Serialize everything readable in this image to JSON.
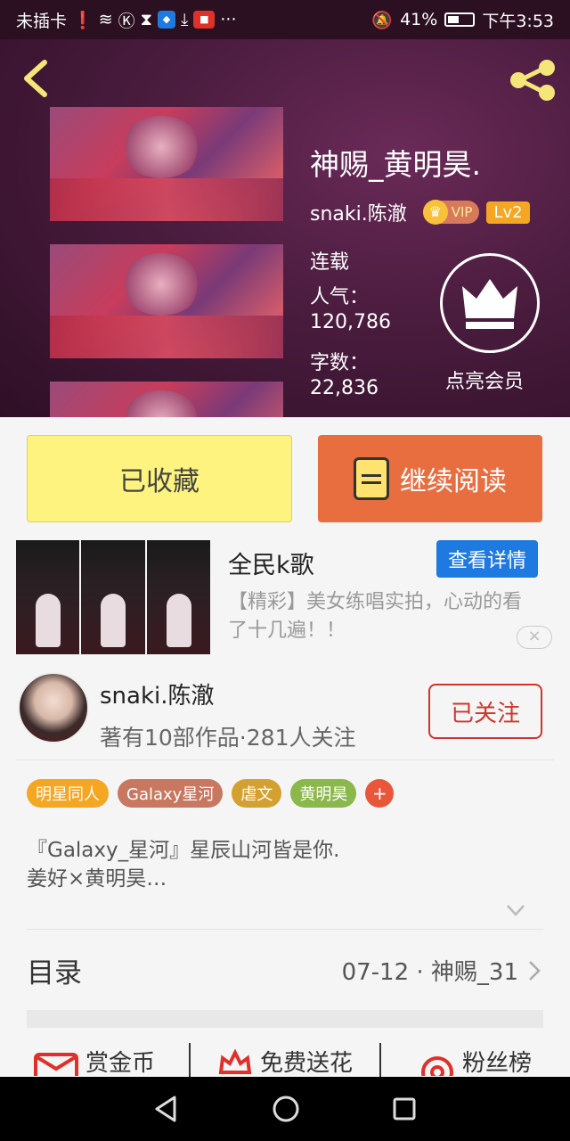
{
  "status_bar": {
    "carrier": "未插卡",
    "battery": "41%",
    "time": "下午3:53",
    "more": "···"
  },
  "book": {
    "title": "神赐_黄明昊.",
    "author": "snaki.陈澈",
    "vip": "VIP",
    "level": "Lv2",
    "status": "连载",
    "popularity_label": "人气：",
    "popularity_value": "120,786",
    "words_label": "字数：",
    "words_value": "22,836",
    "member_label": "点亮会员"
  },
  "actions": {
    "favorited_label": "已收藏",
    "continue_label": "继续阅读"
  },
  "ad": {
    "title": "全民k歌",
    "details_button": "查看详情",
    "description": "【精彩】美女练唱实拍，心动的看了十几遍！！",
    "close": "×"
  },
  "author_block": {
    "name": "snaki.陈澈",
    "works": "著有10部作品·281人关注",
    "follow_label": "已关注"
  },
  "tags": [
    {
      "label": "明星同人",
      "color": "#f5a623"
    },
    {
      "label": "Galaxy星河",
      "color": "#c87860"
    },
    {
      "label": "虐文",
      "color": "#d4a030"
    },
    {
      "label": "黄明昊",
      "color": "#8ab84a"
    }
  ],
  "tag_add": "+",
  "summary": {
    "line1": "『Galaxy_星河』星辰山河皆是你.",
    "line2": "姜好×黄明昊…"
  },
  "toc": {
    "title": "目录",
    "latest": "07-12 · 神赐_31"
  },
  "bottom_actions": [
    {
      "label": "赏金币",
      "icon": "gift-icon"
    },
    {
      "label": "免费送花",
      "icon": "flower-icon"
    },
    {
      "label": "粉丝榜",
      "icon": "fans-icon"
    }
  ],
  "colors": {
    "accent_orange": "#e86e3f",
    "fav_yellow": "#fdf37e",
    "follow_red": "#d0352b",
    "ad_blue": "#1e7ae0"
  }
}
